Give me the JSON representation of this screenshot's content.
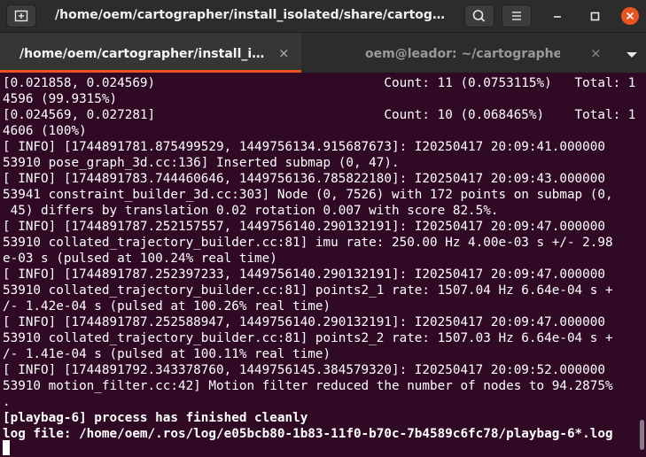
{
  "window": {
    "title": "/home/oem/cartographer/install_isolated/share/cartographer…"
  },
  "header": {
    "new_tab_icon": "new-tab-icon",
    "search_icon": "search-icon",
    "menu_icon": "hamburger-menu-icon",
    "minimize_icon": "minimize-icon",
    "maximize_icon": "maximize-icon",
    "close_icon": "close-icon",
    "close_color": "#e95420"
  },
  "tabs": [
    {
      "label": "/home/oem/cartographer/install_isolated/share/cartographer",
      "close": "×",
      "active": true
    },
    {
      "label": "oem@leador: ~/cartographer",
      "close": "×",
      "active": false
    }
  ],
  "colors": {
    "terminal_bg": "#300a24",
    "accent": "#e95420"
  },
  "terminal": {
    "lines": [
      "[0.021858, 0.024569)                              Count: 11 (0.0753115%)   Total: 1",
      "4596 (99.9315%)",
      "[0.024569, 0.027281]                              Count: 10 (0.068465%)    Total: 1",
      "4606 (100%)",
      "[ INFO] [1744891781.875499529, 1449756134.915687673]: I20250417 20:09:41.000000",
      "53910 pose_graph_3d.cc:136] Inserted submap (0, 47).",
      "[ INFO] [1744891783.744460646, 1449756136.785822180]: I20250417 20:09:43.000000",
      "53941 constraint_builder_3d.cc:303] Node (0, 7526) with 172 points on submap (0,",
      " 45) differs by translation 0.02 rotation 0.007 with score 82.5%.",
      "[ INFO] [1744891787.252157557, 1449756140.290132191]: I20250417 20:09:47.000000",
      "53910 collated_trajectory_builder.cc:81] imu rate: 250.00 Hz 4.00e-03 s +/- 2.98",
      "e-03 s (pulsed at 100.24% real time)",
      "[ INFO] [1744891787.252397233, 1449756140.290132191]: I20250417 20:09:47.000000",
      "53910 collated_trajectory_builder.cc:81] points2_1 rate: 1507.04 Hz 6.64e-04 s +",
      "/- 1.42e-04 s (pulsed at 100.26% real time)",
      "[ INFO] [1744891787.252588947, 1449756140.290132191]: I20250417 20:09:47.000000",
      "53910 collated_trajectory_builder.cc:81] points2_2 rate: 1507.03 Hz 6.64e-04 s +",
      "/- 1.41e-04 s (pulsed at 100.11% real time)",
      "[ INFO] [1744891792.343378760, 1449756145.384579320]: I20250417 20:09:52.000000",
      "53910 motion_filter.cc:42] Motion filter reduced the number of nodes to 94.2875%",
      ".",
      "[playbag-6] process has finished cleanly",
      "log file: /home/oem/.ros/log/e05bcb80-1b83-11f0-b70c-7b4589c6fc78/playbag-6*.log"
    ]
  }
}
